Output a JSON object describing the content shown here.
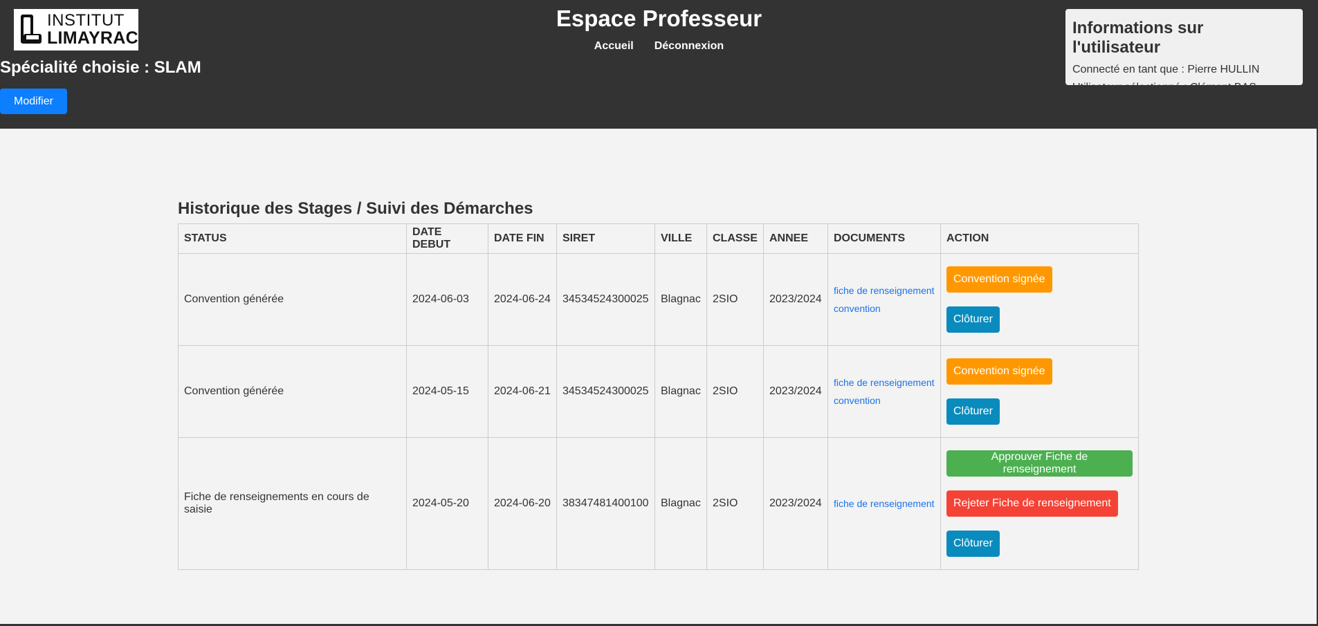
{
  "header": {
    "logo": {
      "line1": "INSTITUT",
      "line2": "LIMAYRAC"
    },
    "specialite": "Spécialité choisie : SLAM",
    "modifier_label": "Modifier",
    "title": "Espace Professeur",
    "nav": [
      "Accueil",
      "Déconnexion"
    ]
  },
  "user_info": {
    "title": "Informations sur l'utilisateur",
    "connected": "Connecté en tant que : Pierre HULLIN",
    "selected": "Utilisateur sélectionné : Clément BAS"
  },
  "main": {
    "title": "Historique des Stages / Suivi des Démarches",
    "columns": [
      "STATUS",
      "DATE DEBUT",
      "DATE FIN",
      "SIRET",
      "VILLE",
      "CLASSE",
      "ANNEE",
      "DOCUMENTS",
      "ACTION"
    ],
    "rows": [
      {
        "status": "Convention générée",
        "date_debut": "2024-06-03",
        "date_fin": "2024-06-24",
        "siret": "34534524300025",
        "ville": "Blagnac",
        "classe": "2SIO",
        "annee": "2023/2024",
        "documents": [
          "fiche de renseignement",
          "convention"
        ],
        "actions": [
          "Convention signée",
          "Clôturer"
        ]
      },
      {
        "status": "Convention générée",
        "date_debut": "2024-05-15",
        "date_fin": "2024-06-21",
        "siret": "34534524300025",
        "ville": "Blagnac",
        "classe": "2SIO",
        "annee": "2023/2024",
        "documents": [
          "fiche de renseignement",
          "convention"
        ],
        "actions": [
          "Convention signée",
          "Clôturer"
        ]
      },
      {
        "status": "Fiche de renseignements en cours de saisie",
        "date_debut": "2024-05-20",
        "date_fin": "2024-06-20",
        "siret": "38347481400100",
        "ville": "Blagnac",
        "classe": "2SIO",
        "annee": "2023/2024",
        "documents": [
          "fiche de renseignement"
        ],
        "actions": [
          "Approuver Fiche de renseignement",
          "Rejeter Fiche de renseignement",
          "Clôturer"
        ]
      }
    ]
  },
  "colors": {
    "header_bg": "#333333",
    "page_bg": "#f3f3f3",
    "primary": "#0d7efd",
    "orange": "#ff9800",
    "teal": "#0a8bbd",
    "green": "#4caf50",
    "red": "#f44336",
    "link": "#1a73e8"
  }
}
